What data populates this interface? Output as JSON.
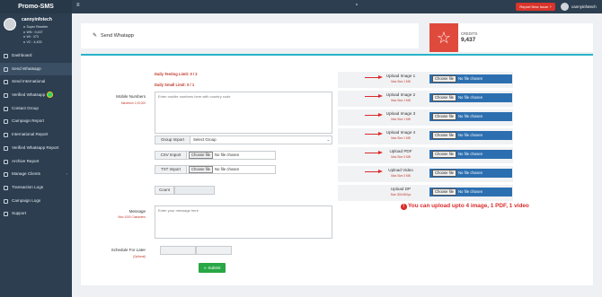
{
  "app": {
    "brand": "Promo-SMS",
    "menu_icon": "hamburger-icon",
    "report_button": "Report New Issue ?",
    "username": "cannyinfotech"
  },
  "profile": {
    "name": "cannyinfotech",
    "role": "Super Reseller",
    "wn": "WN : 9,437",
    "wi": "WI : 373",
    "vc": "VC : 4,433"
  },
  "sidebar": {
    "items": [
      {
        "label": "Dashboard",
        "icon": "dashboard-icon",
        "active": false
      },
      {
        "label": "Send Whatsapp",
        "icon": "send-icon",
        "active": true
      },
      {
        "label": "Send International",
        "icon": "globe-icon",
        "active": false
      },
      {
        "label": "Verified Whatsapp",
        "icon": "whatsapp-icon",
        "active": false
      },
      {
        "label": "Contact Group",
        "icon": "contacts-icon",
        "active": false
      },
      {
        "label": "Campaign Report",
        "icon": "report-icon",
        "active": false
      },
      {
        "label": "International Report",
        "icon": "report-icon",
        "active": false
      },
      {
        "label": "Verified Whatsapp Report",
        "icon": "report-icon",
        "active": false
      },
      {
        "label": "Archive Report",
        "icon": "archive-icon",
        "active": false
      },
      {
        "label": "Manage Clients",
        "icon": "users-icon",
        "active": false
      },
      {
        "label": "Transaction Logs",
        "icon": "logs-icon",
        "active": false
      },
      {
        "label": "Campaign Logs",
        "icon": "logs-icon",
        "active": false
      },
      {
        "label": "Support",
        "icon": "support-icon",
        "active": false
      }
    ]
  },
  "header": {
    "title": "Send Whatapp"
  },
  "credits": {
    "label": "CREDITS",
    "value": "9,437",
    "icon": "star-icon",
    "color": "#e04a3c"
  },
  "form": {
    "daily_testing_limit": "Daily Testing Limit: 0 / 2",
    "daily_small_limit": "Daily Small Limit: 0 / 1",
    "mobile_label": "Mobile Numbers",
    "mobile_sub": "Maximum 1,00,000",
    "mobile_placeholder": "Enter mobile numbers here with country code",
    "group_import_label": "Group Import",
    "group_select_value": "Select Group",
    "csv_import_label": "CSV Import",
    "txt_import_label": "TXT Import",
    "choose_file": "Choose file",
    "no_file": "No file chosen",
    "count_label": "Count",
    "count_value": "",
    "message_label": "Message",
    "message_sub": "Max 1000 Characters",
    "message_placeholder": "Enter your message here",
    "schedule_label": "Schedule For Later",
    "schedule_sub": "(Optional)",
    "schedule_date": "",
    "schedule_time": "",
    "submit_label": "Submit"
  },
  "uploads": [
    {
      "label": "Upload Image 1",
      "size": "Max Size 1 MB"
    },
    {
      "label": "Upload Image 2",
      "size": "Max Size 1 MB"
    },
    {
      "label": "Upload Image 3",
      "size": "Max Size 1 MB"
    },
    {
      "label": "Upload Image 4",
      "size": "Max Size 1 MB"
    },
    {
      "label": "Upload PDF",
      "size": "Max Size 3 MB"
    },
    {
      "label": "Upload Video",
      "size": "Max Size 3 MB"
    },
    {
      "label": "Upload DP",
      "size": "Size 300x300px"
    }
  ],
  "notice": "You can upload upto 4 image, 1 PDF, 1 video",
  "colors": {
    "accent": "#28b3c9",
    "sidebar": "#2c3e50",
    "alert": "#d92b2b",
    "submit": "#28a745"
  }
}
